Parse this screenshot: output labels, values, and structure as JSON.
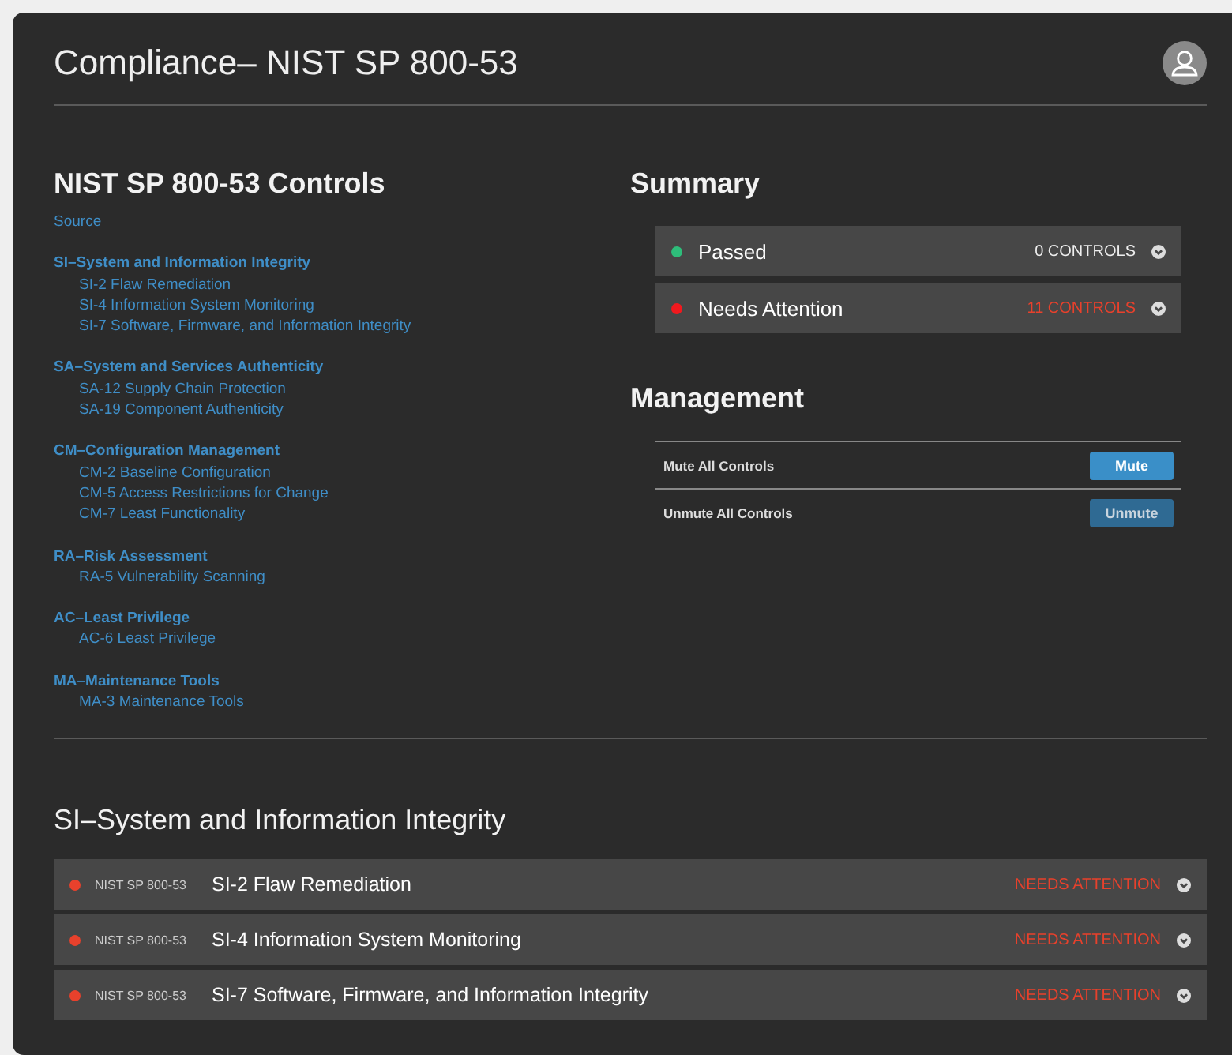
{
  "header": {
    "title": "Compliance– NIST SP 800-53"
  },
  "controls": {
    "title": "NIST SP 800-53 Controls",
    "source": "Source",
    "families": [
      {
        "name": "SI–System and Information Integrity",
        "children": [
          "SI-2 Flaw Remediation",
          "SI-4 Information System Monitoring",
          "SI-7 Software, Firmware, and Information Integrity"
        ]
      },
      {
        "name": "SA–System and Services Authenticity",
        "children": [
          "SA-12 Supply Chain Protection",
          "SA-19 Component Authenticity"
        ]
      },
      {
        "name": "CM–Configuration Management",
        "children": [
          "CM-2 Baseline Configuration",
          "CM-5 Access Restrictions for Change",
          "CM-7 Least Functionality"
        ]
      },
      {
        "name": "RA–Risk Assessment",
        "children": [
          "RA-5 Vulnerability Scanning"
        ]
      },
      {
        "name": "AC–Least Privilege",
        "children": [
          "AC-6 Least Privilege"
        ]
      },
      {
        "name": "MA–Maintenance Tools",
        "children": [
          "MA-3 Maintenance Tools"
        ]
      }
    ]
  },
  "summary": {
    "title": "Summary",
    "items": [
      {
        "label": "Passed",
        "count": "0 CONTROLS",
        "color": "#2ebd7a",
        "kind": "ok"
      },
      {
        "label": "Needs Attention",
        "count": "11 CONTROLS",
        "color": "#f0191e",
        "kind": "alert"
      }
    ]
  },
  "management": {
    "title": "Management",
    "rows": [
      {
        "label": "Mute All Controls",
        "button": "Mute",
        "disabled": false
      },
      {
        "label": "Unmute All Controls",
        "button": "Unmute",
        "disabled": true
      }
    ]
  },
  "section": {
    "title": "SI–System and Information Integrity",
    "rows": [
      {
        "standard": "NIST SP 800-53",
        "name": "SI-2 Flaw Remediation",
        "status": "NEEDS ATTENTION",
        "color": "#e8412c"
      },
      {
        "standard": "NIST SP 800-53",
        "name": "SI-4 Information System Monitoring",
        "status": "NEEDS ATTENTION",
        "color": "#e8412c"
      },
      {
        "standard": "NIST SP 800-53",
        "name": "SI-7 Software, Firmware, and Information Integrity",
        "status": "NEEDS ATTENTION",
        "color": "#e8412c"
      }
    ]
  }
}
